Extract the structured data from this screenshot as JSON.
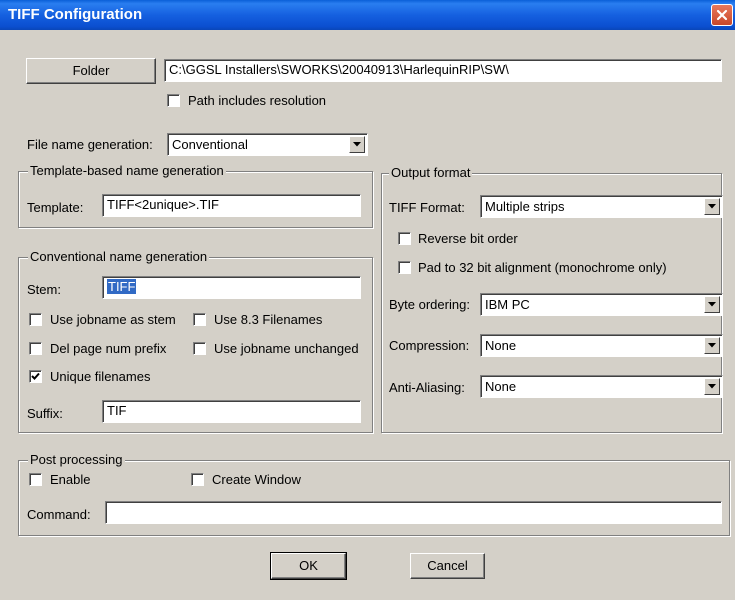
{
  "window": {
    "title": "TIFF Configuration"
  },
  "folder": {
    "button_label": "Folder",
    "path_value": "C:\\GGSL Installers\\SWORKS\\20040913\\HarlequinRIP\\SW\\",
    "path_includes_resolution": {
      "label": "Path includes resolution",
      "checked": false
    }
  },
  "file_name_generation": {
    "label": "File name generation:",
    "value": "Conventional"
  },
  "template_group": {
    "title": "Template-based name generation",
    "template_label": "Template:",
    "template_value": "TIFF<2unique>.TIF"
  },
  "conventional_group": {
    "title": "Conventional name generation",
    "stem_label": "Stem:",
    "stem_value": "TIFF",
    "use_jobname_as_stem": {
      "label": "Use jobname as stem",
      "checked": false
    },
    "use_8_3_filenames": {
      "label": "Use 8.3 Filenames",
      "checked": false
    },
    "del_page_num_prefix": {
      "label": "Del page num prefix",
      "checked": false
    },
    "use_jobname_unchanged": {
      "label": "Use jobname unchanged",
      "checked": false
    },
    "unique_filenames": {
      "label": "Unique filenames",
      "checked": true
    },
    "suffix_label": "Suffix:",
    "suffix_value": "TIF"
  },
  "output_format": {
    "title": "Output format",
    "tiff_format_label": "TIFF Format:",
    "tiff_format_value": "Multiple strips",
    "reverse_bit_order": {
      "label": "Reverse bit order",
      "checked": false
    },
    "pad_32": {
      "label": "Pad to 32 bit alignment (monochrome only)",
      "checked": false
    },
    "byte_ordering_label": "Byte ordering:",
    "byte_ordering_value": "IBM PC",
    "compression_label": "Compression:",
    "compression_value": "None",
    "anti_aliasing_label": "Anti-Aliasing:",
    "anti_aliasing_value": "None"
  },
  "post_processing": {
    "title": "Post processing",
    "enable": {
      "label": "Enable",
      "checked": false
    },
    "create_window": {
      "label": "Create Window",
      "checked": false
    },
    "command_label": "Command:",
    "command_value": ""
  },
  "buttons": {
    "ok": "OK",
    "cancel": "Cancel"
  }
}
